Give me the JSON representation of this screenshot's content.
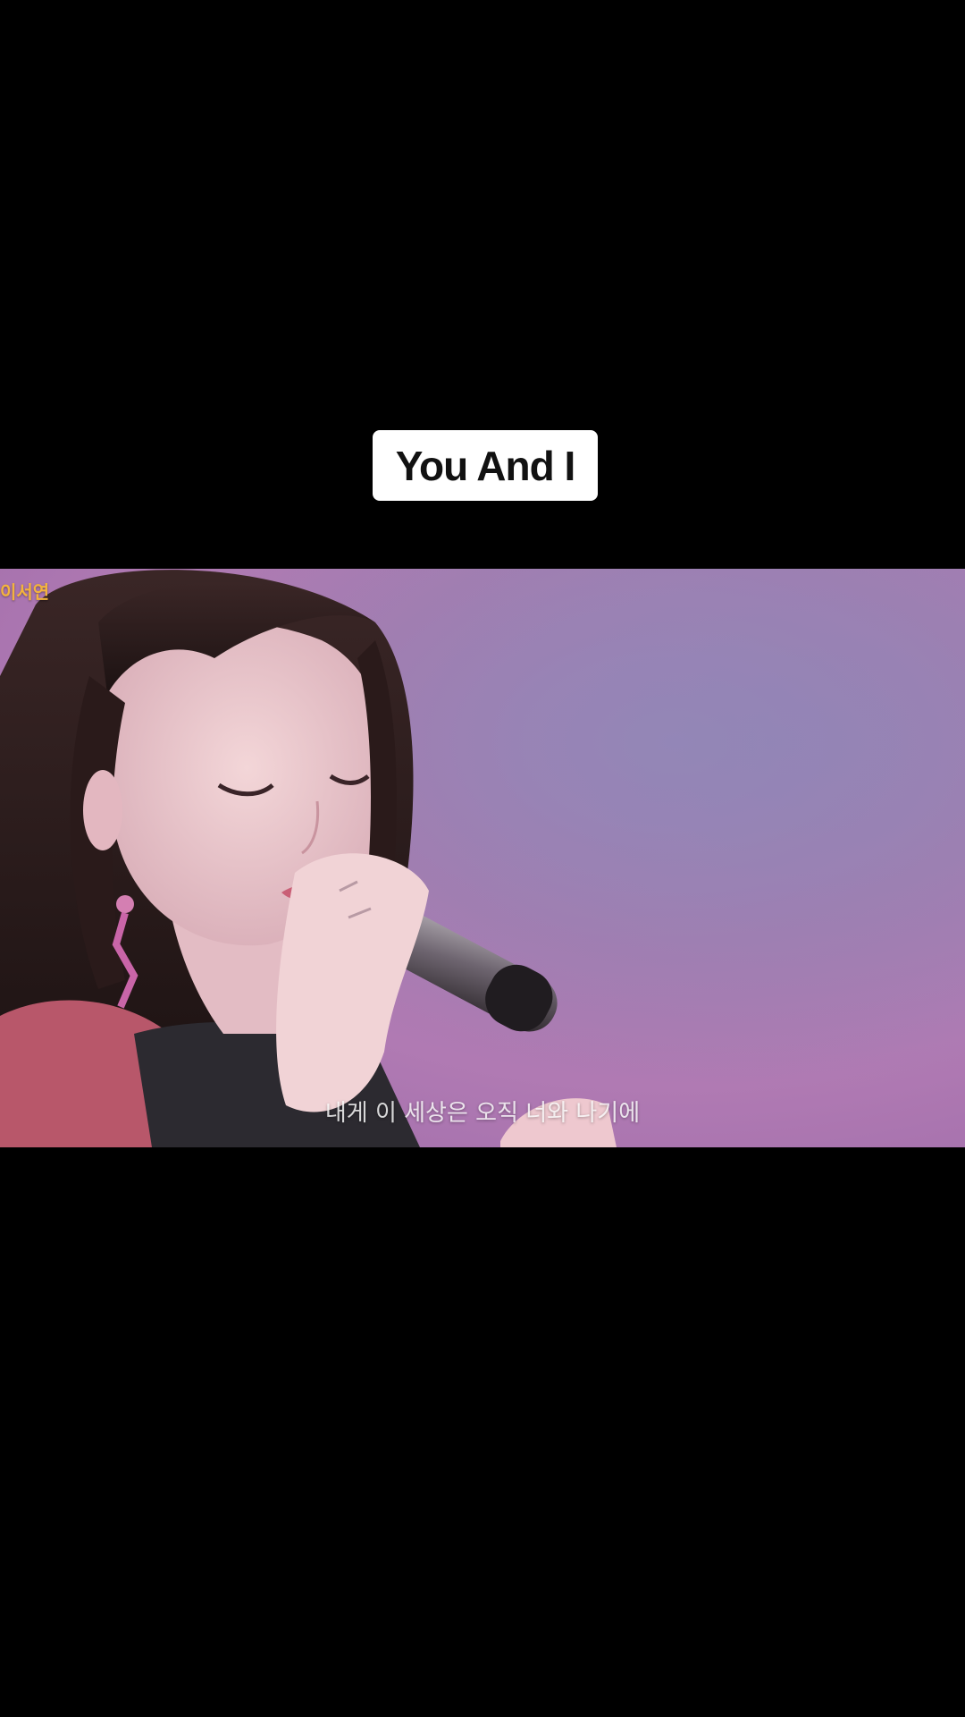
{
  "caption": {
    "title": "You And I"
  },
  "video": {
    "channel_tag": "이서연",
    "subtitle": "내게 이 세상은 오직 너와 나기에",
    "scene": "singer-with-microphone",
    "colors": {
      "background": "#000000",
      "stage_purple": "#a57cb0",
      "channel_tag": "#f3b33d"
    }
  }
}
